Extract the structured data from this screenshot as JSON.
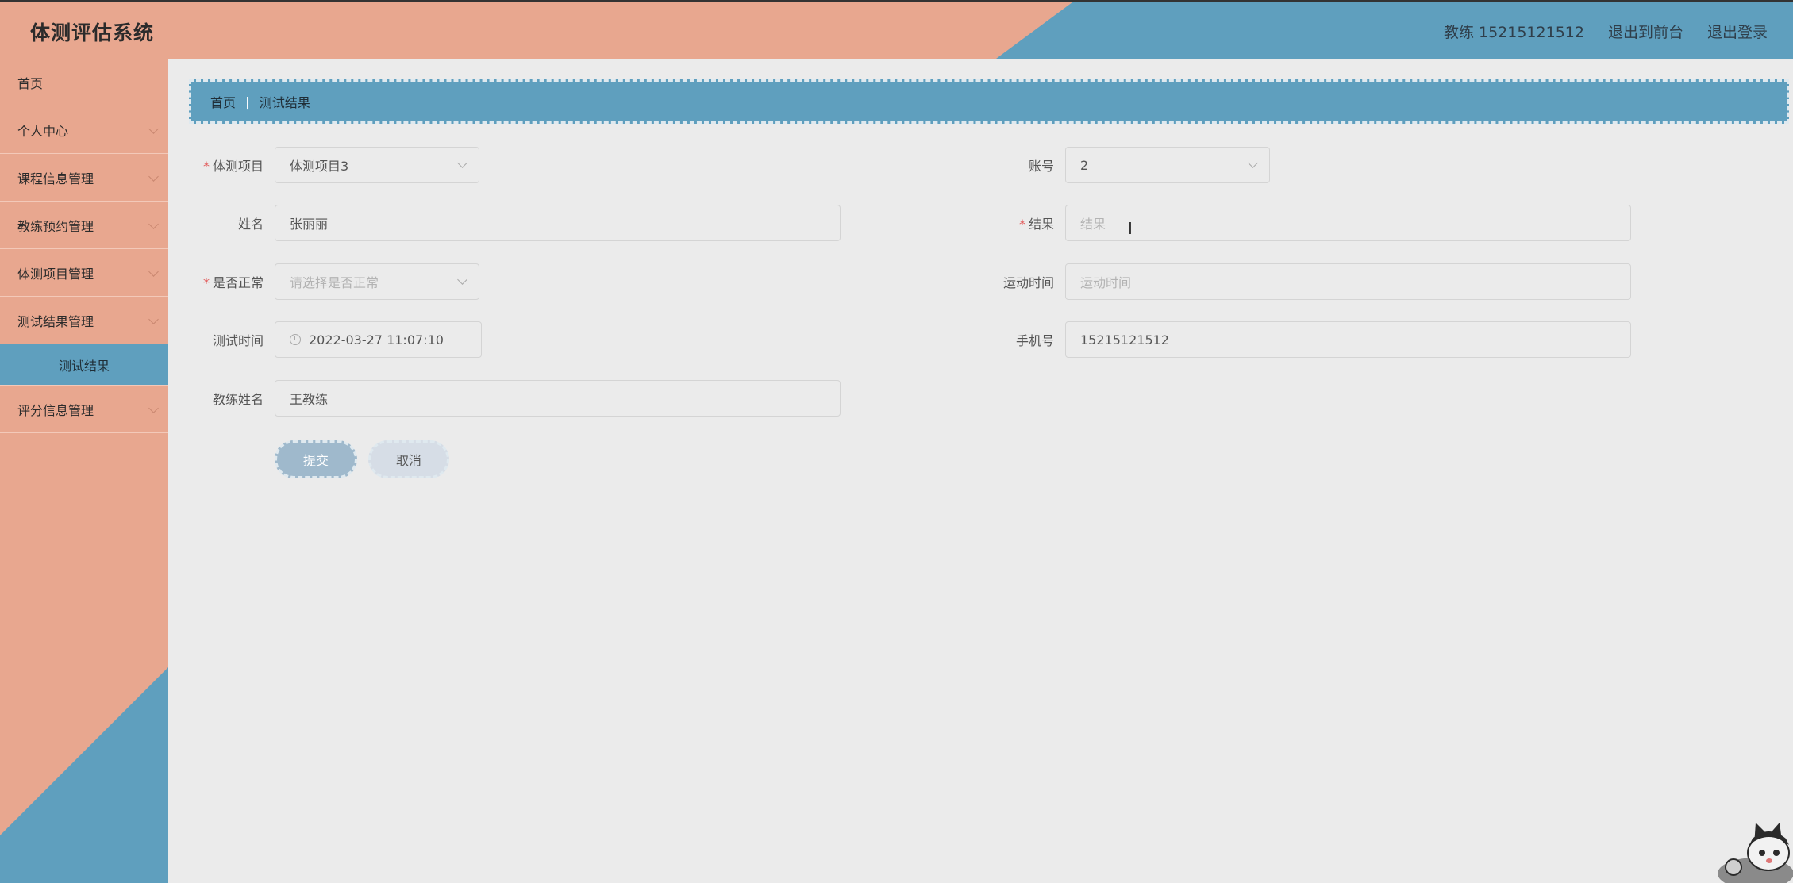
{
  "header": {
    "title": "体测评估系统",
    "user": "教练 15215121512",
    "back_front": "退出到前台",
    "logout": "退出登录"
  },
  "sidebar": {
    "items": [
      {
        "label": "首页"
      },
      {
        "label": "个人中心"
      },
      {
        "label": "课程信息管理"
      },
      {
        "label": "教练预约管理"
      },
      {
        "label": "体测项目管理"
      },
      {
        "label": "测试结果管理"
      },
      {
        "label": "测试结果",
        "sub": true
      },
      {
        "label": "评分信息管理"
      }
    ]
  },
  "breadcrumb": {
    "home": "首页",
    "separator": "|",
    "current": "测试结果"
  },
  "form": {
    "project": {
      "label": "体测项目",
      "value": "体测项目3"
    },
    "account": {
      "label": "账号",
      "value": "2"
    },
    "name": {
      "label": "姓名",
      "value": "张丽丽"
    },
    "result": {
      "label": "结果",
      "placeholder": "结果"
    },
    "normal": {
      "label": "是否正常",
      "placeholder": "请选择是否正常"
    },
    "exercise_time": {
      "label": "运动时间",
      "placeholder": "运动时间"
    },
    "test_time": {
      "label": "测试时间",
      "value": "2022-03-27 11:07:10"
    },
    "phone": {
      "label": "手机号",
      "value": "15215121512"
    },
    "coach": {
      "label": "教练姓名",
      "value": "王教练"
    },
    "submit": "提交",
    "cancel": "取消"
  },
  "colors": {
    "salmon": "#e8a78f",
    "blue": "#5f9fbe",
    "background": "#ebebeb"
  }
}
